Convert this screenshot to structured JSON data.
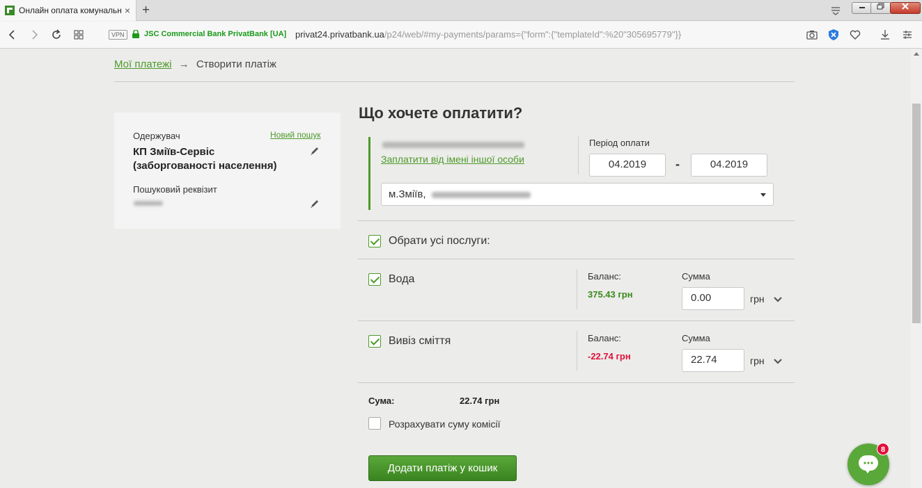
{
  "browser": {
    "tab_title": "Онлайн оплата комунальних послуг",
    "tab_close": "×",
    "new_tab": "+",
    "vpn_label": "VPN",
    "site_name": "JSC Commercial Bank PrivatBank [UA]",
    "url_domain": "privat24.privatbank.ua",
    "url_path": "/p24/web/#my-payments/params={\"form\":{\"templateId\":%20\"305695779\"}}"
  },
  "breadcrumb": {
    "link": "Мої платежі",
    "arrow": "→",
    "current": "Створити платіж"
  },
  "recipient_card": {
    "recipient_label": "Одержувач",
    "new_search_link": "Новий пошук",
    "recipient_name_line1": "КП Зміїв-Сервіс",
    "recipient_name_line2": "(заборгованості населення)",
    "search_detail_label": "Пошуковий реквізит"
  },
  "form": {
    "heading": "Що хочете оплатити?",
    "pay_for_other_link": "Заплатити від імені іншої особи",
    "period_label": "Період оплати",
    "period_from": "04.2019",
    "period_dash": "-",
    "period_to": "04.2019",
    "address_select": "м.Зміїв,",
    "select_all_label": "Обрати усі послуги:",
    "balance_label": "Баланс:",
    "amount_label": "Сумма",
    "currency": "грн",
    "services": [
      {
        "name": "Вода",
        "balance": "375.43 грн",
        "amount": "0.00",
        "checked": true
      },
      {
        "name": "Вивіз сміття",
        "balance": "-22.74 грн",
        "amount": "22.74",
        "checked": true
      }
    ],
    "sum_label": "Сума:",
    "sum_value": "22.74 грн",
    "commission_label": "Розрахувати суму комісії",
    "submit_button": "Додати платіж у кошик"
  },
  "chat": {
    "badge_count": "8"
  },
  "colors": {
    "accent_green": "#4d9a2a",
    "negative_red": "#e0103a",
    "positive_green": "#3a8a1a"
  }
}
